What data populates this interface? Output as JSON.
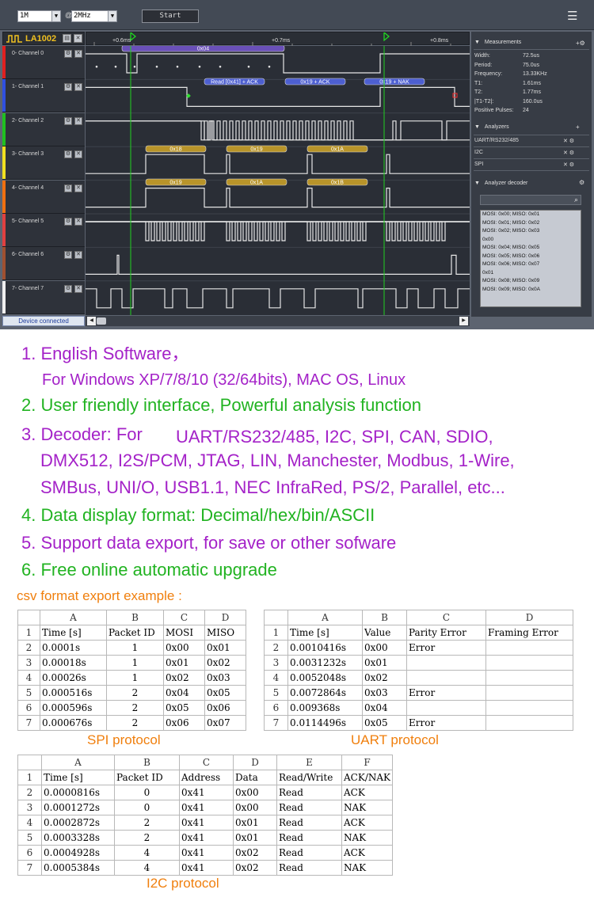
{
  "app": {
    "toolbar": {
      "samples": "1M",
      "at": "@",
      "rate": "2MHz",
      "start_label": "Start"
    },
    "device_name": "LA1002",
    "timeline": {
      "t1": "+0.6ms",
      "t2": "+0.7ms",
      "t3": "+0.8ms"
    },
    "channels": [
      {
        "name": "0- Channel 0",
        "color": "#e02020"
      },
      {
        "name": "1- Channel 1",
        "color": "#3050e0"
      },
      {
        "name": "2- Channel 2",
        "color": "#20c020"
      },
      {
        "name": "3- Channel 3",
        "color": "#f0e020"
      },
      {
        "name": "4- Channel 4",
        "color": "#f07010"
      },
      {
        "name": "5- Channel 5",
        "color": "#e04040"
      },
      {
        "name": "6- Channel 6",
        "color": "#a05030"
      },
      {
        "name": "7- Channel 7",
        "color": "#f0f0f0"
      }
    ],
    "decodes": {
      "ch0": [
        "0x04"
      ],
      "ch1": [
        "Read [0x41] + ACK",
        "0x19 + ACK",
        "0x19 + NAK"
      ],
      "ch3": [
        "0x18",
        "0x19",
        "0x1A"
      ],
      "ch4": [
        "0x19",
        "0x1A",
        "0x1B"
      ]
    },
    "status": "Device connected",
    "measurements": {
      "title": "Measurements",
      "rows": [
        {
          "label": "Width:",
          "value": "72.5us"
        },
        {
          "label": "Period:",
          "value": "75.0us"
        },
        {
          "label": "Frequency:",
          "value": "13.33KHz"
        },
        {
          "label": "T1:",
          "value": "1.61ms"
        },
        {
          "label": "T2:",
          "value": "1.77ms"
        },
        {
          "label": "|T1-T2|:",
          "value": "160.0us"
        },
        {
          "label": "Positive Pulses:",
          "value": "24"
        }
      ]
    },
    "analyzers": {
      "title": "Analyzers",
      "items": [
        "UART/RS232/485",
        "I2C",
        "SPI"
      ]
    },
    "decoder": {
      "title": "Analyzer decoder",
      "rows": [
        "MOSI: 0x00;  MISO: 0x01",
        "MOSI: 0x01;  MISO: 0x02",
        "MOSI: 0x02;  MISO: 0x03",
        "0x00",
        "MOSI: 0x04;  MISO: 0x05",
        "MOSI: 0x05;  MISO: 0x06",
        "MOSI: 0x06;  MISO: 0x07",
        "0x01",
        "MOSI: 0x08;  MISO: 0x09",
        "MOSI: 0x09;  MISO: 0x0A"
      ]
    }
  },
  "features": {
    "l1": "1. English Software，",
    "l1b": "For Windows XP/7/8/10 (32/64bits), MAC OS, Linux",
    "l2": "2. User friendly interface, Powerful analysis function",
    "l3a": "3. Decoder: For",
    "l3b": "UART/RS232/485, I2C, SPI, CAN, SDIO,",
    "l3c": "DMX512, I2S/PCM, JTAG, LIN, Manchester, Modbus, 1-Wire,",
    "l3d": "SMBus, UNI/O, USB1.1, NEC InfraRed, PS/2, Parallel, etc...",
    "l4": "4. Data display format: Decimal/hex/bin/ASCII",
    "l5": "5. Support data export, for save or other sofware",
    "l6": "6. Free online automatic upgrade",
    "csv_title": "csv format export example :"
  },
  "tables": {
    "spi": {
      "caption": "SPI protocol",
      "cols": [
        "A",
        "B",
        "C",
        "D"
      ],
      "rows": [
        [
          "1",
          "Time [s]",
          "Packet ID",
          "MOSI",
          "MISO"
        ],
        [
          "2",
          "0.0001s",
          "1",
          "0x00",
          "0x01"
        ],
        [
          "3",
          "0.00018s",
          "1",
          "0x01",
          "0x02"
        ],
        [
          "4",
          "0.00026s",
          "1",
          "0x02",
          "0x03"
        ],
        [
          "5",
          "0.000516s",
          "2",
          "0x04",
          "0x05"
        ],
        [
          "6",
          "0.000596s",
          "2",
          "0x05",
          "0x06"
        ],
        [
          "7",
          "0.000676s",
          "2",
          "0x06",
          "0x07"
        ]
      ]
    },
    "uart": {
      "caption": "UART protocol",
      "cols": [
        "A",
        "B",
        "C",
        "D"
      ],
      "rows": [
        [
          "1",
          "Time [s]",
          "Value",
          "Parity Error",
          "Framing Error"
        ],
        [
          "2",
          "0.0010416s",
          "0x00",
          "Error",
          ""
        ],
        [
          "3",
          "0.0031232s",
          "0x01",
          "",
          ""
        ],
        [
          "4",
          "0.0052048s",
          "0x02",
          "",
          ""
        ],
        [
          "5",
          "0.0072864s",
          "0x03",
          "Error",
          ""
        ],
        [
          "6",
          "0.009368s",
          "0x04",
          "",
          ""
        ],
        [
          "7",
          "0.0114496s",
          "0x05",
          "Error",
          ""
        ]
      ]
    },
    "i2c": {
      "caption": "I2C protocol",
      "cols": [
        "A",
        "B",
        "C",
        "D",
        "E",
        "F"
      ],
      "rows": [
        [
          "1",
          "Time [s]",
          "Packet ID",
          "Address",
          "Data",
          "Read/Write",
          "ACK/NAK"
        ],
        [
          "2",
          "0.0000816s",
          "0",
          "0x41",
          "0x00",
          "Read",
          "ACK"
        ],
        [
          "3",
          "0.0001272s",
          "0",
          "0x41",
          "0x00",
          "Read",
          "NAK"
        ],
        [
          "4",
          "0.0002872s",
          "2",
          "0x41",
          "0x01",
          "Read",
          "ACK"
        ],
        [
          "5",
          "0.0003328s",
          "2",
          "0x41",
          "0x01",
          "Read",
          "NAK"
        ],
        [
          "6",
          "0.0004928s",
          "4",
          "0x41",
          "0x02",
          "Read",
          "ACK"
        ],
        [
          "7",
          "0.0005384s",
          "4",
          "0x41",
          "0x02",
          "Read",
          "NAK"
        ]
      ]
    }
  }
}
